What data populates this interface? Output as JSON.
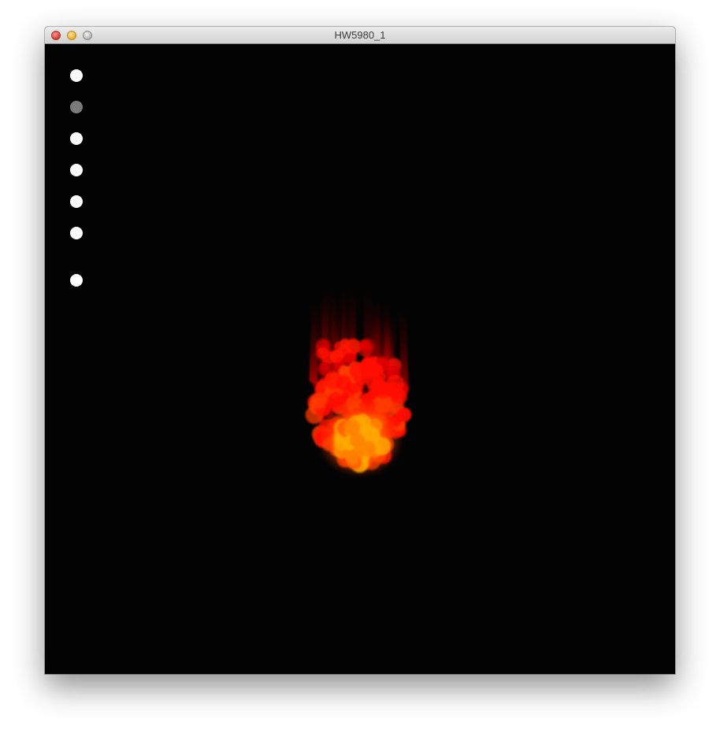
{
  "window": {
    "title": "HW5980_1"
  },
  "controls": {
    "dots": [
      {
        "id": "dot-1",
        "color": "#ffffff"
      },
      {
        "id": "dot-2",
        "color": "#7a7a7a"
      },
      {
        "id": "dot-3",
        "color": "#ffffff"
      },
      {
        "id": "dot-4",
        "color": "#ffffff"
      },
      {
        "id": "dot-5",
        "color": "#ffffff"
      },
      {
        "id": "dot-6",
        "color": "#ffffff"
      },
      {
        "id": "dot-7",
        "color": "#ffffff"
      }
    ]
  },
  "colors": {
    "canvas_background": "#030303",
    "fire_outer": "#ff1a00",
    "fire_mid": "#ff3b00",
    "fire_core": "#ffa000",
    "trail": "#6a0000"
  }
}
